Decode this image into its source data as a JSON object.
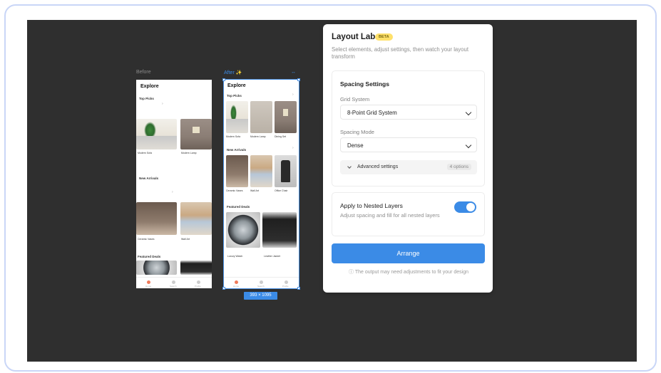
{
  "canvas": {
    "before_label": "Before",
    "after_label": "After ✨",
    "size_badge": "393 × 1095"
  },
  "phone_before": {
    "title": "Explore",
    "section_top_picks": "Top Picks",
    "item_1": "Modern Sofa",
    "item_2": "Modern Lamp",
    "section_new_arrivals": "New Arrivals",
    "item_3": "Ceramic Vases",
    "item_4": "Wall Art",
    "section_featured": "Featured Deals",
    "nav": [
      "Home",
      "Search",
      "Profile"
    ]
  },
  "phone_after": {
    "title": "Explore",
    "section_top_picks": "Top Picks",
    "items_top": [
      "Modern Sofa",
      "Modern Lamp",
      "Dining Set"
    ],
    "section_new_arrivals": "New Arrivals",
    "items_new": [
      "Ceramic Vases",
      "Wall Art",
      "Office Chair"
    ],
    "section_featured": "Featured Deals",
    "featured_1": "Luxury Watch",
    "featured_2": "Leather Jacket",
    "nav": [
      "Home",
      "Search",
      "Profile"
    ]
  },
  "panel": {
    "title": "Layout Lab",
    "badge": "BETA",
    "description": "Select elements, adjust settings, then watch your layout transform",
    "spacing_settings": {
      "title": "Spacing Settings",
      "grid_label": "Grid System",
      "grid_value": "8-Point Grid System",
      "mode_label": "Spacing Mode",
      "mode_value": "Dense",
      "advanced_label": "Advanced settings",
      "advanced_badge": "4 options"
    },
    "nested": {
      "title": "Apply to Nested Layers",
      "description": "Adjust spacing and fill for all nested layers",
      "enabled": true
    },
    "arrange_label": "Arrange",
    "note": "ⓘ The output may need adjustments to fit your design"
  },
  "colors": {
    "accent": "#3b8be6",
    "canvas": "#2f2f2f",
    "beta": "#ffe16b"
  }
}
